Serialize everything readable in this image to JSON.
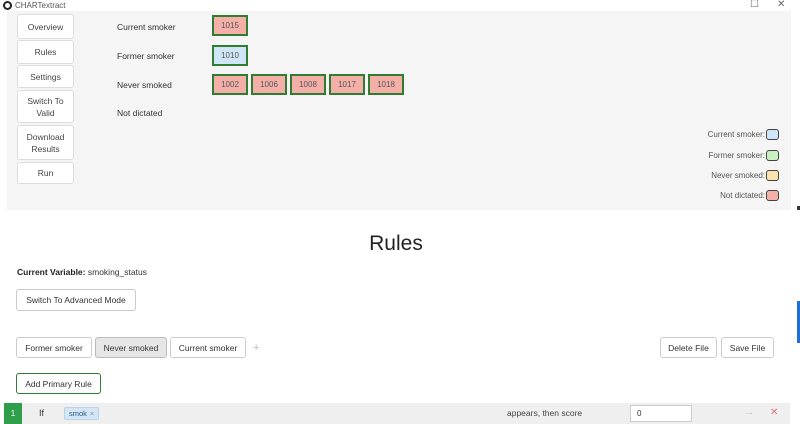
{
  "window": {
    "title": "CHARTextract",
    "minimize": "☐",
    "close": "✕"
  },
  "nav": {
    "overview": "Overview",
    "rules": "Rules",
    "settings": "Settings",
    "switch_to_valid": "Switch To Valid",
    "download_results": "Download Results",
    "run": "Run"
  },
  "values": [
    {
      "label": "Current smoker",
      "chips": [
        "1015"
      ]
    },
    {
      "label": "Former smoker",
      "chips": [
        "1010"
      ]
    },
    {
      "label": "Never smoked",
      "chips": [
        "1002",
        "1006",
        "1008",
        "1017",
        "1018"
      ]
    },
    {
      "label": "Not dictated",
      "chips": []
    }
  ],
  "legend": [
    {
      "label": "Current smoker:",
      "color": "#cfe6f7"
    },
    {
      "label": "Former smoker:",
      "color": "#c8f0c0"
    },
    {
      "label": "Never smoked:",
      "color": "#fbe3b0"
    },
    {
      "label": "Not dictated:",
      "color": "#f4b0a8"
    }
  ],
  "rules": {
    "title": "Rules",
    "current_variable_label": "Current Variable:",
    "current_variable_value": "smoking_status",
    "advanced_mode_button": "Switch To Advanced Mode",
    "tabs": [
      "Former smoker",
      "Never smoked",
      "Current smoker"
    ],
    "active_tab": "Never smoked",
    "add_tab_icon": "+",
    "delete_file": "Delete File",
    "save_file": "Save File",
    "add_primary_rule": "Add Primary Rule"
  },
  "rule_row": {
    "index": "1",
    "if_label": "If",
    "tag": "smok",
    "tag_remove": "×",
    "text": "appears, then score",
    "score": "0",
    "arrow_icon": "→",
    "delete_icon": "✕"
  },
  "colors": {
    "accent_green": "#2e7d32",
    "rule_index_green": "#2e9e4a",
    "chip_red": "#f4b0a8",
    "chip_blue": "#cfe6f7"
  }
}
